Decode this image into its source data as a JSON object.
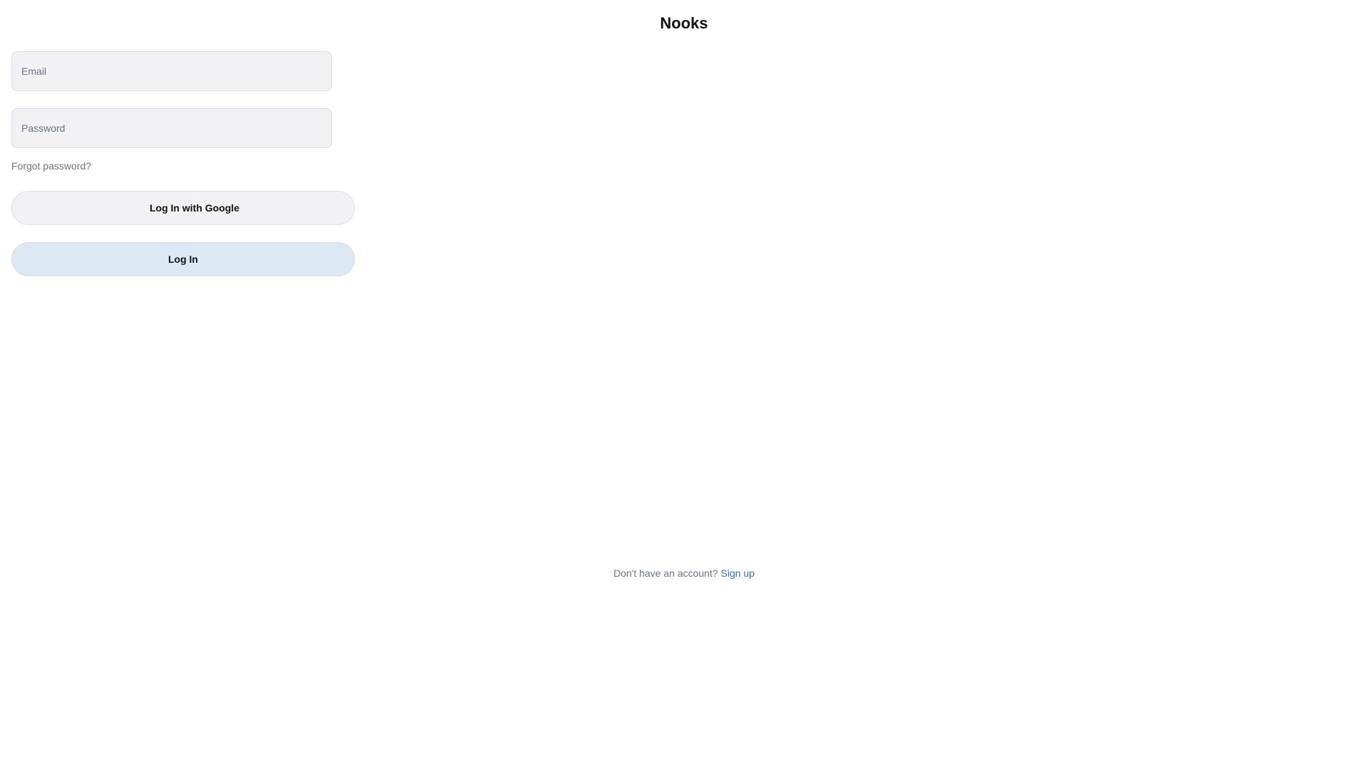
{
  "app": {
    "title": "Nooks"
  },
  "login_form": {
    "email_placeholder": "Email",
    "email_value": "",
    "password_placeholder": "Password",
    "password_value": "",
    "forgot_password_label": "Forgot password?",
    "google_button_label": "Log In with Google",
    "login_button_label": "Log In"
  },
  "footer": {
    "prompt_text": "Don't have an account?",
    "signup_label": "Sign up"
  },
  "colors": {
    "input_background": "#f2f2f4",
    "login_button_background": "#dce8f3",
    "link_accent": "#2f6fcb",
    "muted_text": "#6b7280"
  }
}
